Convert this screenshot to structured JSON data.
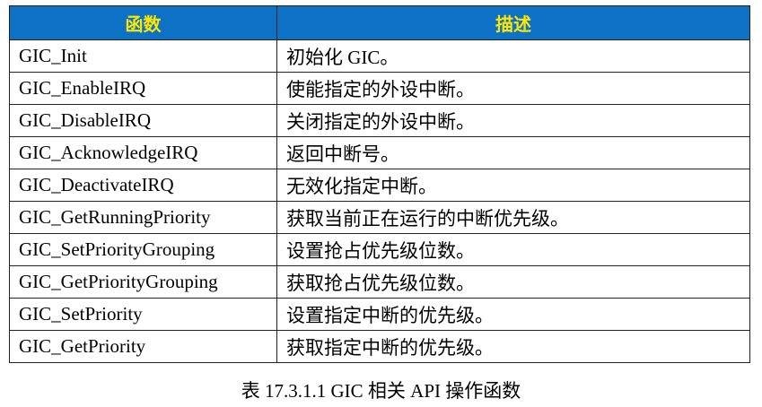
{
  "table": {
    "headers": [
      "函数",
      "描述"
    ],
    "rows": [
      [
        "GIC_Init",
        "初始化 GIC。"
      ],
      [
        "GIC_EnableIRQ",
        "使能指定的外设中断。"
      ],
      [
        "GIC_DisableIRQ",
        "关闭指定的外设中断。"
      ],
      [
        "GIC_AcknowledgeIRQ",
        "返回中断号。"
      ],
      [
        "GIC_DeactivateIRQ",
        "无效化指定中断。"
      ],
      [
        "GIC_GetRunningPriority",
        "获取当前正在运行的中断优先级。"
      ],
      [
        "GIC_SetPriorityGrouping",
        "设置抢占优先级位数。"
      ],
      [
        "GIC_GetPriorityGrouping",
        "获取抢占优先级位数。"
      ],
      [
        "GIC_SetPriority",
        "设置指定中断的优先级。"
      ],
      [
        "GIC_GetPriority",
        "获取指定中断的优先级。"
      ]
    ]
  },
  "caption": "表 17.3.1.1 GIC 相关 API 操作函数",
  "colors": {
    "header_bg": "#0d72c6",
    "header_text": "#ffe600",
    "border": "#222222"
  }
}
